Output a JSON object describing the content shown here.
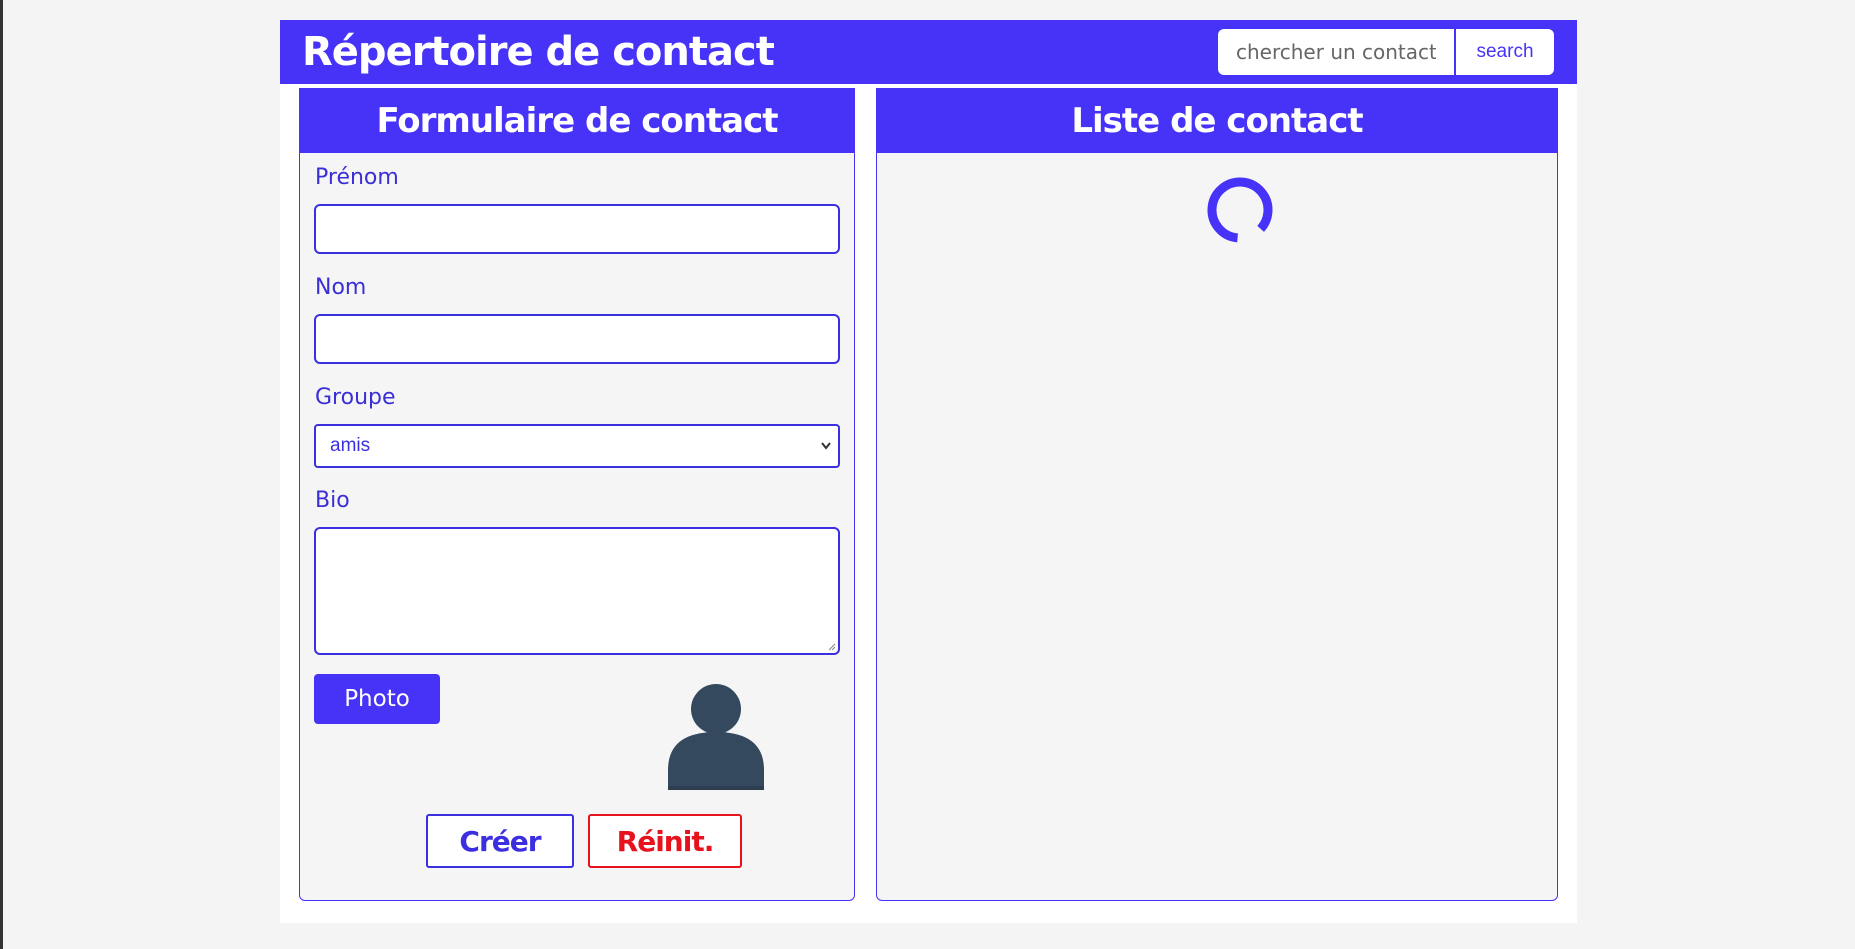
{
  "header": {
    "title": "Répertoire de contact",
    "search_placeholder": "chercher un contact",
    "search_button_label": "search"
  },
  "form_panel": {
    "title": "Formulaire de contact",
    "first_name": {
      "label": "Prénom",
      "value": ""
    },
    "last_name": {
      "label": "Nom",
      "value": ""
    },
    "group": {
      "label": "Groupe",
      "selected": "amis"
    },
    "bio": {
      "label": "Bio",
      "value": ""
    },
    "photo_button_label": "Photo",
    "create_button_label": "Créer",
    "reset_button_label": "Réinit."
  },
  "list_panel": {
    "title": "Liste de contact",
    "state": "loading"
  },
  "colors": {
    "accent": "#4733f7",
    "danger": "#e8121d",
    "avatar": "#34495e",
    "background": "#f4f4f4"
  },
  "icons": {
    "avatar": "user-silhouette-icon",
    "loading": "spinner-icon",
    "select_arrow": "chevron-down-icon"
  }
}
